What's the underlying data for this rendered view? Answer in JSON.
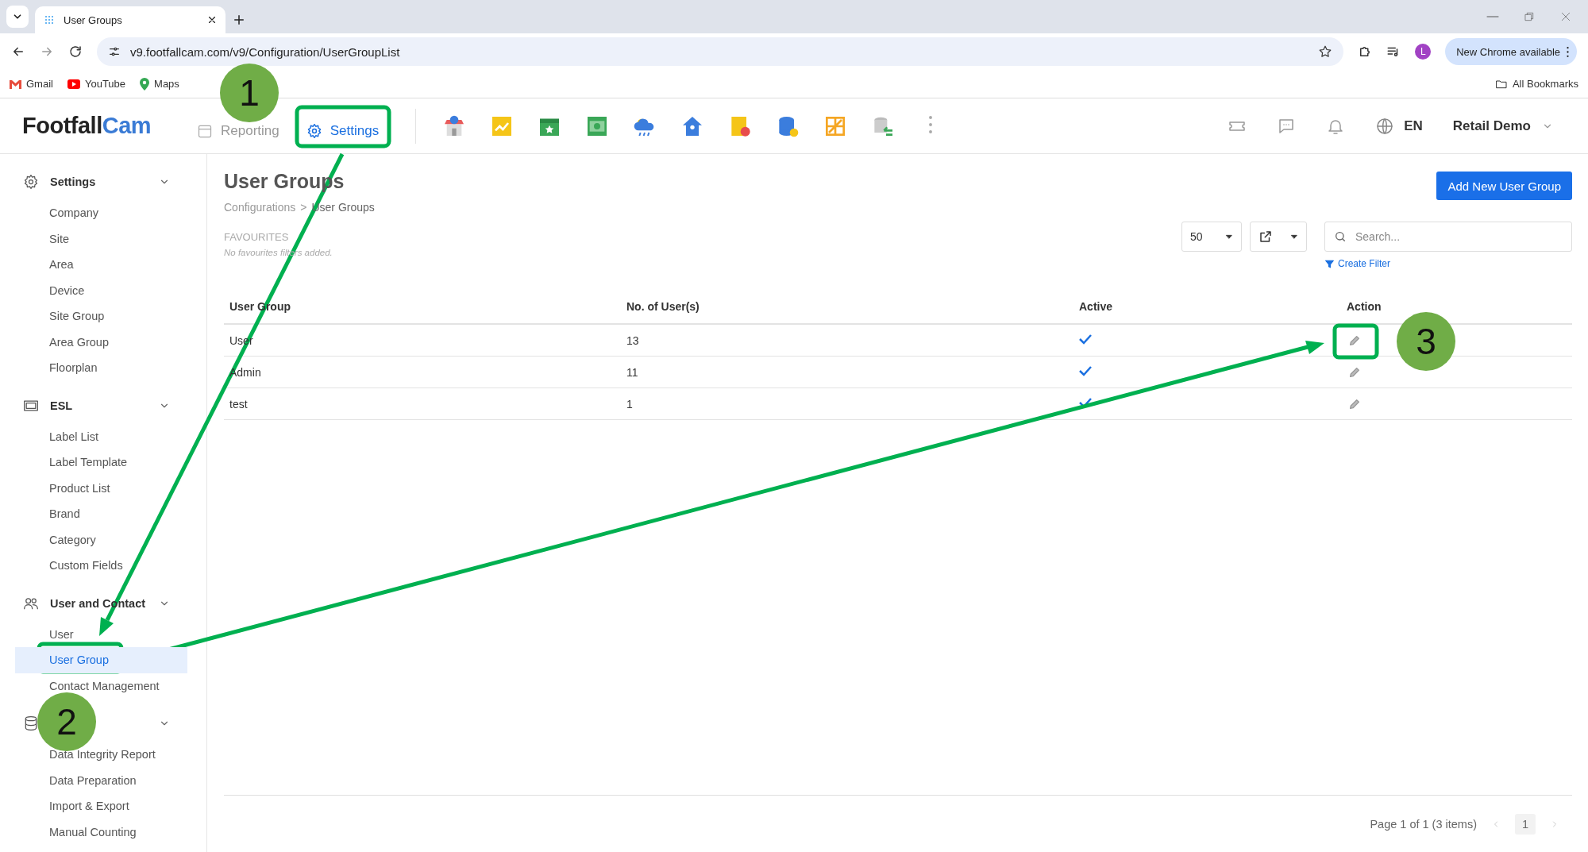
{
  "browser": {
    "tab_title": "User Groups",
    "url": "v9.footfallcam.com/v9/Configuration/UserGroupList",
    "profile_initial": "L",
    "update_label": "New Chrome available",
    "bookmarks": [
      "Gmail",
      "YouTube",
      "Maps"
    ],
    "all_bookmarks": "All Bookmarks"
  },
  "header": {
    "logo": {
      "part_1": "Footfall",
      "part_2": "Cam"
    },
    "nav": [
      {
        "label": "Reporting",
        "selected": false
      },
      {
        "label": "Settings",
        "selected": true
      }
    ],
    "language": "EN",
    "account": "Retail Demo"
  },
  "sidebar": [
    {
      "label": "Settings",
      "kind": "gear",
      "expanded": true,
      "items": [
        {
          "label": "Company",
          "selected": false
        },
        {
          "label": "Site",
          "selected": false
        },
        {
          "label": "Area",
          "selected": false
        },
        {
          "label": "Device",
          "selected": false
        },
        {
          "label": "Site Group",
          "selected": false
        },
        {
          "label": "Area Group",
          "selected": false
        },
        {
          "label": "Floorplan",
          "selected": false
        }
      ]
    },
    {
      "label": "ESL",
      "kind": "screen",
      "expanded": true,
      "items": [
        {
          "label": "Label List",
          "selected": false
        },
        {
          "label": "Label Template",
          "selected": false
        },
        {
          "label": "Product List",
          "selected": false
        },
        {
          "label": "Brand",
          "selected": false
        },
        {
          "label": "Category",
          "selected": false
        },
        {
          "label": "Custom Fields",
          "selected": false
        }
      ]
    },
    {
      "label": "User and Contact",
      "kind": "users",
      "expanded": true,
      "items": [
        {
          "label": "User",
          "selected": false
        },
        {
          "label": "User Group",
          "selected": true
        },
        {
          "label": "Contact Management",
          "selected": false
        }
      ]
    },
    {
      "kind": "database",
      "expanded": true,
      "items": [
        {
          "label": "Data Integrity Report",
          "selected": false
        },
        {
          "label": "Data Preparation",
          "selected": false
        },
        {
          "label": "Import & Export",
          "selected": false
        },
        {
          "label": "Manual Counting",
          "selected": false
        }
      ]
    }
  ],
  "page": {
    "title": "User Groups",
    "breadcrumb": [
      "Configurations",
      "User Groups"
    ],
    "breadcrumb_separator": ">",
    "favourites_label": "FAVOURITES",
    "favourites_empty": "No favourites filters added.",
    "add_button": "Add New User Group",
    "page_size": "50",
    "search": {
      "placeholder": "Search..."
    },
    "create_filter": "Create Filter"
  },
  "table": {
    "columns": [
      "User Group",
      "No. of User(s)",
      "Active",
      "Action"
    ],
    "rows": [
      {
        "user_group": "User",
        "users": "13",
        "active": true
      },
      {
        "user_group": "Admin",
        "users": "11",
        "active": true
      },
      {
        "user_group": "test",
        "users": "1",
        "active": true
      }
    ]
  },
  "pagination": {
    "summary": "Page 1 of 1 (3 items)",
    "pages": [
      {
        "label": "1",
        "selected": true
      }
    ]
  },
  "annotations": [
    {
      "number": "1"
    },
    {
      "number": "2"
    },
    {
      "number": "3"
    }
  ]
}
